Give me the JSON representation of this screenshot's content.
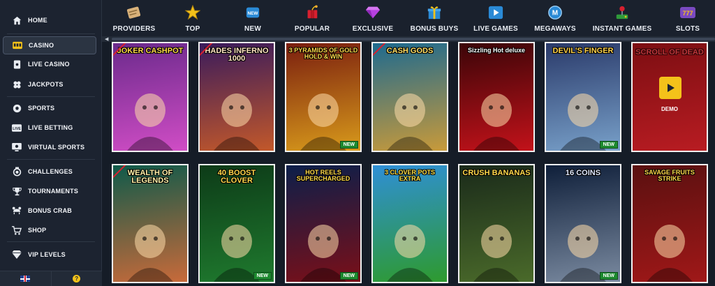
{
  "sidebar": {
    "items": [
      {
        "label": "HOME",
        "icon": "home-icon"
      },
      {
        "label": "CASINO",
        "icon": "slot-machine-icon",
        "active": true
      },
      {
        "label": "LIVE CASINO",
        "icon": "card-icon"
      },
      {
        "label": "JACKPOTS",
        "icon": "clover-icon"
      },
      {
        "label": "SPORTS",
        "icon": "football-icon"
      },
      {
        "label": "LIVE BETTING",
        "icon": "live-icon"
      },
      {
        "label": "VIRTUAL SPORTS",
        "icon": "virtual-sports-icon"
      },
      {
        "label": "CHALLENGES",
        "icon": "medal-icon"
      },
      {
        "label": "TOURNAMENTS",
        "icon": "trophy-icon"
      },
      {
        "label": "BONUS CRAB",
        "icon": "crab-icon"
      },
      {
        "label": "SHOP",
        "icon": "cart-icon"
      },
      {
        "label": "VIP LEVELS",
        "icon": "diamond-icon"
      }
    ],
    "footer": {
      "help_label": "?"
    }
  },
  "categories": [
    {
      "label": "PROVIDERS",
      "icon": "scroll-icon"
    },
    {
      "label": "TOP",
      "icon": "star-icon"
    },
    {
      "label": "NEW",
      "icon": "new-badge-icon"
    },
    {
      "label": "POPULAR",
      "icon": "dynamite-icon"
    },
    {
      "label": "EXCLUSIVE",
      "icon": "gem-icon"
    },
    {
      "label": "BONUS BUYS",
      "icon": "gift-icon"
    },
    {
      "label": "LIVE GAMES",
      "icon": "play-icon"
    },
    {
      "label": "MEGAWAYS",
      "icon": "megaways-icon"
    },
    {
      "label": "INSTANT GAMES",
      "icon": "joystick-icon"
    },
    {
      "label": "SLOTS",
      "icon": "slots-777-icon"
    }
  ],
  "games": [
    {
      "title": "JOKER CASHPOT",
      "exclusive": true,
      "bg": [
        "#6b2a8c",
        "#d04dc5"
      ],
      "title_color": "#ffd84a"
    },
    {
      "title": "HADES INFERNO 1000",
      "exclusive": true,
      "bg": [
        "#3a1b5c",
        "#c2582a"
      ],
      "title_color": "#ffe3c2"
    },
    {
      "title": "3 PYRAMIDS OF GOLD HOLD & WIN",
      "bg": [
        "#7a1e0f",
        "#d89a1b"
      ],
      "title_color": "#ffd84a",
      "badge": "NEW"
    },
    {
      "title": "CASH GODS",
      "exclusive": true,
      "bg": [
        "#1e6a8f",
        "#c89a3a"
      ],
      "title_color": "#ffe066"
    },
    {
      "title": "Sizzling Hot deluxe",
      "bg": [
        "#3b0508",
        "#c2121a"
      ],
      "title_color": "#ffffff"
    },
    {
      "title": "DEVIL'S FINGER",
      "bg": [
        "#2a3a6a",
        "#78a0c9"
      ],
      "title_color": "#ffd24a",
      "badge": "NEW"
    },
    {
      "title": "SCROLL OF DEAD",
      "bg": [
        "#7c0e12",
        "#b81c22"
      ],
      "title_color": "#d6454a",
      "demo": true,
      "demo_label": "DEMO"
    },
    {
      "title": "WEALTH OF LEGENDS",
      "exclusive": true,
      "bg": [
        "#0f5a4a",
        "#c86a3a"
      ],
      "title_color": "#fff1a8"
    },
    {
      "title": "40 BOOST CLOVER",
      "bg": [
        "#0d3b18",
        "#1f7a2e"
      ],
      "title_color": "#ffd84a",
      "badge": "NEW"
    },
    {
      "title": "HOT REELS SUPERCHARGED",
      "bg": [
        "#0c1f4a",
        "#7a0f18"
      ],
      "title_color": "#ffd84a",
      "badge": "NEW"
    },
    {
      "title": "3 CLOVER POTS EXTRA",
      "bg": [
        "#2f8fd6",
        "#2e9a2e"
      ],
      "title_color": "#ffe24a"
    },
    {
      "title": "CRUSH BANANAS",
      "bg": [
        "#1a2a1a",
        "#4a6a2a"
      ],
      "title_color": "#ffd84a"
    },
    {
      "title": "16 COINS",
      "bg": [
        "#0f1f3a",
        "#7a8aa0"
      ],
      "title_color": "#dfe8ff",
      "badge": "NEW"
    },
    {
      "title": "SAVAGE FRUITS STRIKE",
      "bg": [
        "#5a1010",
        "#a01818"
      ],
      "title_color": "#ffd84a"
    }
  ],
  "accent": "#f4c21a"
}
